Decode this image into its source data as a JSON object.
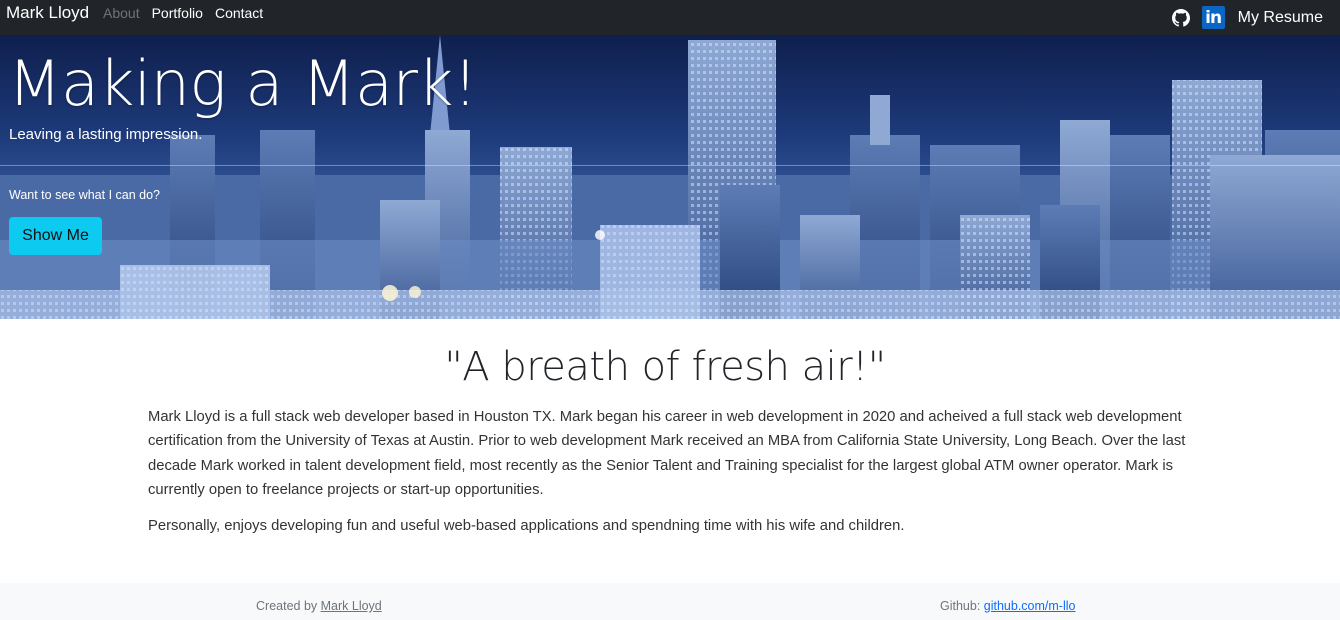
{
  "navbar": {
    "brand": "Mark Lloyd",
    "links": [
      "About",
      "Portfolio",
      "Contact"
    ],
    "linkedin_glyph": "in",
    "resume_label": "My Resume",
    "icons": [
      "github-icon",
      "linkedin-icon"
    ]
  },
  "hero": {
    "title": "Making a Mark!",
    "subtitle": "Leaving a lasting impression.",
    "question": "Want to see what I can do?",
    "button_label": "Show Me",
    "button_color": "#0dcaf0"
  },
  "main": {
    "quote": "\"A breath of fresh air!\"",
    "bio": "Mark Lloyd is a full stack web developer based in Houston TX. Mark began his career in web development in 2020 and acheived a full stack web development certification from the University of Texas at Austin. Prior to web development Mark received an MBA from California State University, Long Beach. Over the last decade Mark worked in talent development field, most recently as the Senior Talent and Training specialist for the largest global ATM owner operator. Mark is currently open to freelance projects or start-up opportunities.",
    "personal": "Personally, enjoys developing fun and useful web-based applications and spendning time with his wife and children."
  },
  "footer": {
    "created_prefix": "Created by ",
    "created_name": "Mark Lloyd",
    "github_prefix": "Github: ",
    "github_link": "github.com/m-llo",
    "link_color": "#0d6efd"
  },
  "colors": {
    "navbar_bg": "#212529",
    "footer_bg": "#f8f9fa"
  }
}
